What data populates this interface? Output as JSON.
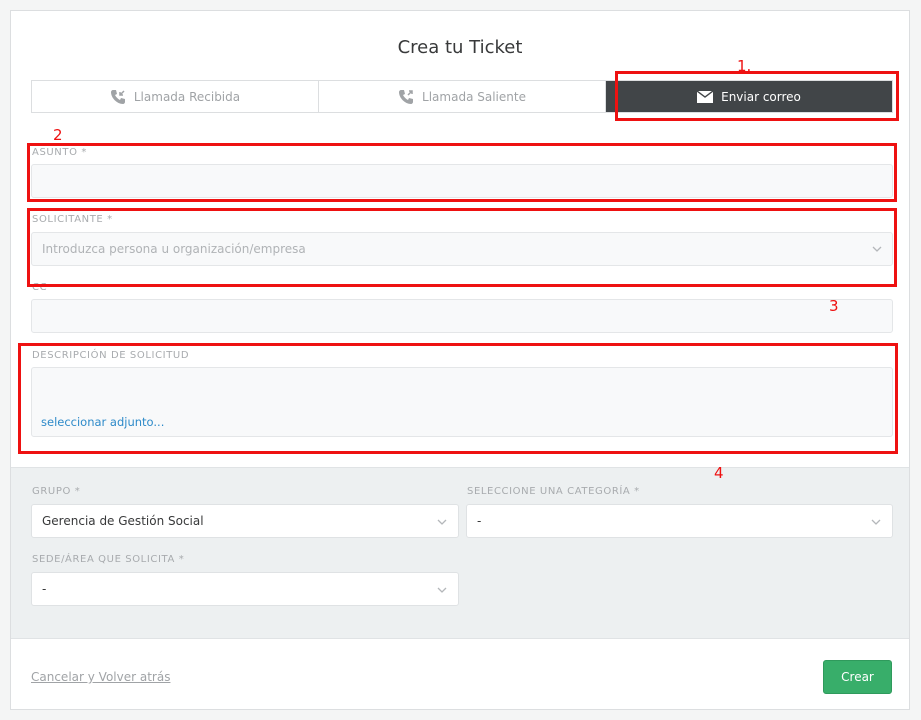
{
  "form": {
    "title": "Crea tu Ticket",
    "tabs": [
      {
        "label": "Llamada Recibida",
        "icon": "phone-in-icon",
        "active": false
      },
      {
        "label": "Llamada Saliente",
        "icon": "phone-out-icon",
        "active": false
      },
      {
        "label": "Enviar correo",
        "icon": "mail-icon",
        "active": true
      }
    ],
    "asunto": {
      "label": "ASUNTO *",
      "value": ""
    },
    "solicitante": {
      "label": "SOLICITANTE *",
      "placeholder": "Introduzca persona u organización/empresa"
    },
    "cc": {
      "label": "CC",
      "value": ""
    },
    "descripcion": {
      "label": "DESCRIPCIÓN DE SOLICITUD",
      "attach_label": "seleccionar adjunto..."
    }
  },
  "attributes": {
    "grupo": {
      "label": "GRUPO *",
      "value": "Gerencia de Gestión Social"
    },
    "categoria": {
      "label": "SELECCIONE UNA CATEGORÍA *",
      "value": "-"
    },
    "sede": {
      "label": "SEDE/ÁREA QUE SOLICITA *",
      "value": "-"
    }
  },
  "footer": {
    "cancel_label": "Cancelar y Volver atrás",
    "create_label": "Crear"
  },
  "annotations": [
    "1.",
    "2",
    "3",
    "4"
  ],
  "colors": {
    "annotation": "#ee1111",
    "active_tab": "#414548",
    "create_button": "#38ae6a",
    "link": "#2d8ac9"
  }
}
